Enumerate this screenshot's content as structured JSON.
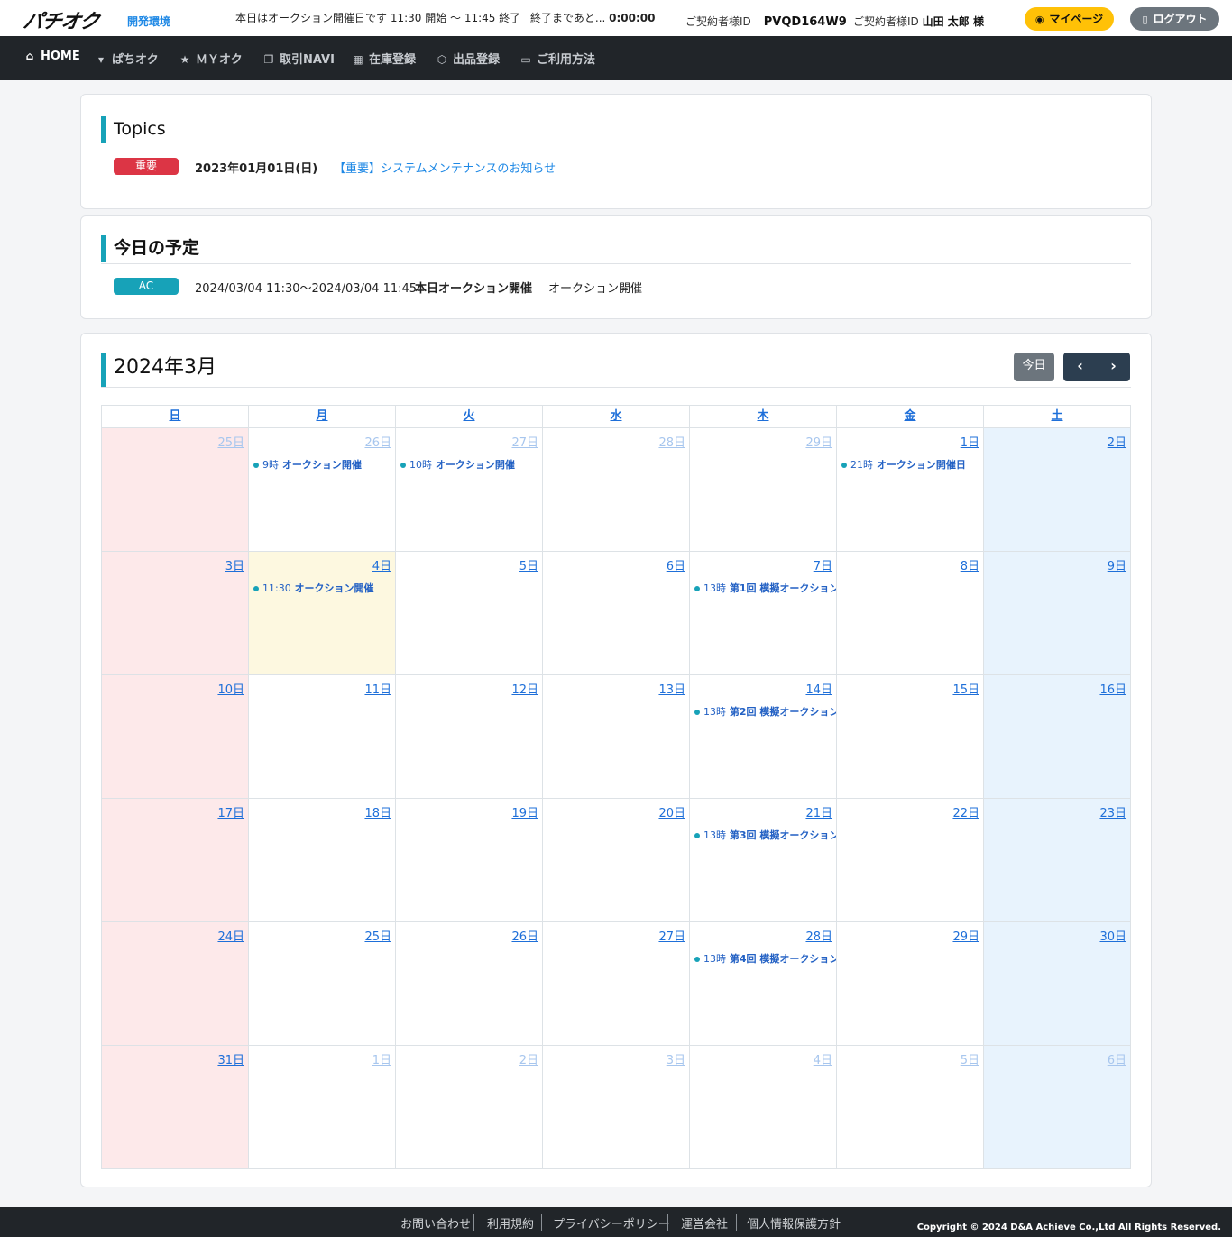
{
  "header": {
    "logo": "パチオク",
    "env": "開発環境",
    "notice": "本日はオークション開催日です 11:30 開始 ～ 11:45 終了",
    "countdown_label": "終了まであと...",
    "countdown_value": "0:00:00",
    "contract_label": "ご契約者様ID",
    "contract_id": "PVQD164W9",
    "user_label": "ご契約者様ID",
    "user_name": "山田 太郎 様",
    "mypage": "マイページ",
    "logout": "ログアウト"
  },
  "nav": [
    {
      "icon": "home-icon",
      "glyph": "⌂",
      "label": "HOME"
    },
    {
      "icon": "cart-icon",
      "glyph": "🛒",
      "label": "ぱちオク"
    },
    {
      "icon": "star-icon",
      "glyph": "★",
      "label": "ＭＹオク"
    },
    {
      "icon": "copy-icon",
      "glyph": "❐",
      "label": "取引NAVI"
    },
    {
      "icon": "building-icon",
      "glyph": "▦",
      "label": "在庫登録"
    },
    {
      "icon": "box-icon",
      "glyph": "⬡",
      "label": "出品登録"
    },
    {
      "icon": "book-icon",
      "glyph": "▭",
      "label": "ご利用方法"
    }
  ],
  "topics": {
    "title": "Topics",
    "items": [
      {
        "badge": "重要",
        "date": "2023年01月01日(日)",
        "text": "【重要】システムメンテナンスのお知らせ"
      }
    ]
  },
  "today": {
    "title": "今日の予定",
    "items": [
      {
        "badge": "AC",
        "period": "2024/03/04 11:30～2024/03/04 11:45",
        "name": "本日オークション開催",
        "desc": "オークション開催"
      }
    ]
  },
  "calendar": {
    "title": "2024年3月",
    "today_button": "今日",
    "prev": "‹",
    "next": "›",
    "weekdays": [
      "日",
      "月",
      "火",
      "水",
      "木",
      "金",
      "土"
    ],
    "weeks": [
      [
        {
          "label": "25日",
          "other": true
        },
        {
          "label": "26日",
          "other": true,
          "event": {
            "time": "9時",
            "title": "オークション開催"
          }
        },
        {
          "label": "27日",
          "other": true,
          "event": {
            "time": "10時",
            "title": "オークション開催"
          }
        },
        {
          "label": "28日",
          "other": true
        },
        {
          "label": "29日",
          "other": true
        },
        {
          "label": "1日",
          "event": {
            "time": "21時",
            "title": "オークション開催日"
          }
        },
        {
          "label": "2日"
        }
      ],
      [
        {
          "label": "3日"
        },
        {
          "label": "4日",
          "today": true,
          "event": {
            "time": "11:30",
            "title": "オークション開催"
          }
        },
        {
          "label": "5日"
        },
        {
          "label": "6日"
        },
        {
          "label": "7日",
          "event": {
            "time": "13時",
            "title": "第1回 模擬オークション"
          }
        },
        {
          "label": "8日"
        },
        {
          "label": "9日"
        }
      ],
      [
        {
          "label": "10日"
        },
        {
          "label": "11日"
        },
        {
          "label": "12日"
        },
        {
          "label": "13日"
        },
        {
          "label": "14日",
          "event": {
            "time": "13時",
            "title": "第2回 模擬オークション"
          }
        },
        {
          "label": "15日"
        },
        {
          "label": "16日"
        }
      ],
      [
        {
          "label": "17日"
        },
        {
          "label": "18日"
        },
        {
          "label": "19日"
        },
        {
          "label": "20日"
        },
        {
          "label": "21日",
          "event": {
            "time": "13時",
            "title": "第3回 模擬オークション"
          }
        },
        {
          "label": "22日"
        },
        {
          "label": "23日"
        }
      ],
      [
        {
          "label": "24日"
        },
        {
          "label": "25日"
        },
        {
          "label": "26日"
        },
        {
          "label": "27日"
        },
        {
          "label": "28日",
          "event": {
            "time": "13時",
            "title": "第4回 模擬オークション"
          }
        },
        {
          "label": "29日"
        },
        {
          "label": "30日"
        }
      ],
      [
        {
          "label": "31日"
        },
        {
          "label": "1日",
          "other": true
        },
        {
          "label": "2日",
          "other": true
        },
        {
          "label": "3日",
          "other": true
        },
        {
          "label": "4日",
          "other": true
        },
        {
          "label": "5日",
          "other": true
        },
        {
          "label": "6日",
          "other": true
        }
      ]
    ]
  },
  "footer": {
    "links": [
      "お問い合わせ",
      "利用規約",
      "プライバシーポリシー",
      "運営会社",
      "個人情報保護方針"
    ],
    "copyright": "Copyright © 2024 D&A Achieve Co.,Ltd All Rights Reserved."
  },
  "colors": {
    "accent": "#17a2b8",
    "nav_bg": "#212529",
    "mypage_button": "#ffc107",
    "logout_button": "#6c757d",
    "important_badge": "#dc3545",
    "sunday_bg": "#fde9ea",
    "saturday_bg": "#e8f3fd",
    "today_bg": "#fdf8e0"
  }
}
